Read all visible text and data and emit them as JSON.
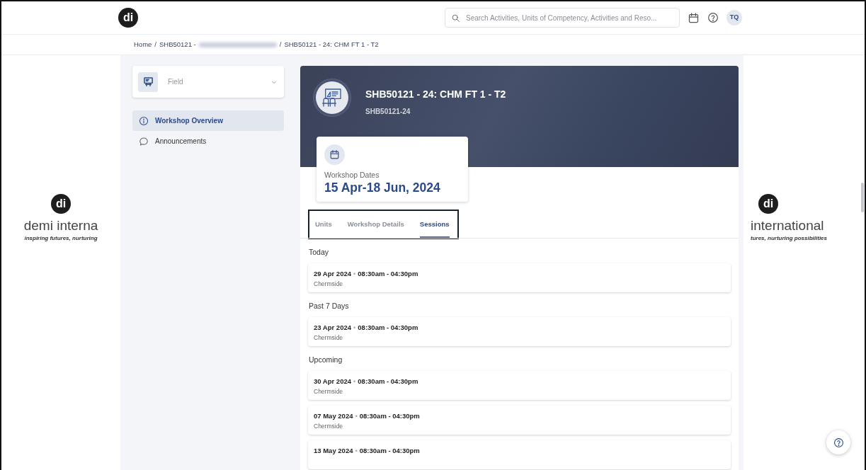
{
  "header": {
    "logo": "di",
    "search": {
      "placeholder": "Search Activities, Units of Competency, Activities and Reso..."
    },
    "avatar": "TQ"
  },
  "breadcrumb": [
    {
      "label": "Home"
    },
    {
      "separator": "/",
      "label": "SHB50121 -",
      "redacted": true
    },
    {
      "separator": "/",
      "label": "SHB50121 - 24: CHM FT 1 - T2"
    }
  ],
  "background_logos": [
    {
      "mark": "di",
      "name": "demi interna",
      "tagline": "inspiring futures, nurturing"
    },
    {
      "mark": "di",
      "name": "international",
      "tagline": "tures, nurturing possibilities"
    }
  ],
  "sidebar": {
    "selector": {
      "label": "Field"
    },
    "items": [
      {
        "label": "Workshop Overview",
        "kind": "info",
        "selected": true
      },
      {
        "label": "Announcements",
        "kind": "chat",
        "selected": false
      }
    ]
  },
  "workshop": {
    "title": "SHB50121 - 24: CHM FT 1 - T2",
    "code": "SHB50121-24",
    "dates_label": "Workshop Dates",
    "dates": "15 Apr-18 Jun, 2024"
  },
  "tabs": [
    {
      "label": "Units",
      "selected": false
    },
    {
      "label": "Workshop Details",
      "selected": false
    },
    {
      "label": "Sessions",
      "selected": true
    }
  ],
  "session_groups": [
    {
      "heading": "Today",
      "sessions": [
        {
          "date": "29 Apr 2024",
          "separator": "•",
          "time": "08:30am - 04:30pm",
          "location": "Chermside"
        }
      ]
    },
    {
      "heading": "Past 7 Days",
      "sessions": [
        {
          "date": "23 Apr 2024",
          "separator": "•",
          "time": "08:30am - 04:30pm",
          "location": "Chermside"
        }
      ]
    },
    {
      "heading": "Upcoming",
      "sessions": [
        {
          "date": "30 Apr 2024",
          "separator": "•",
          "time": "08:30am - 04:30pm",
          "location": "Chermside"
        },
        {
          "date": "07 May 2024",
          "separator": "•",
          "time": "08:30am - 04:30pm",
          "location": "Chermside"
        },
        {
          "date": "13 May 2024",
          "separator": "•",
          "time": "08:30am - 04:30pm"
        }
      ]
    }
  ]
}
